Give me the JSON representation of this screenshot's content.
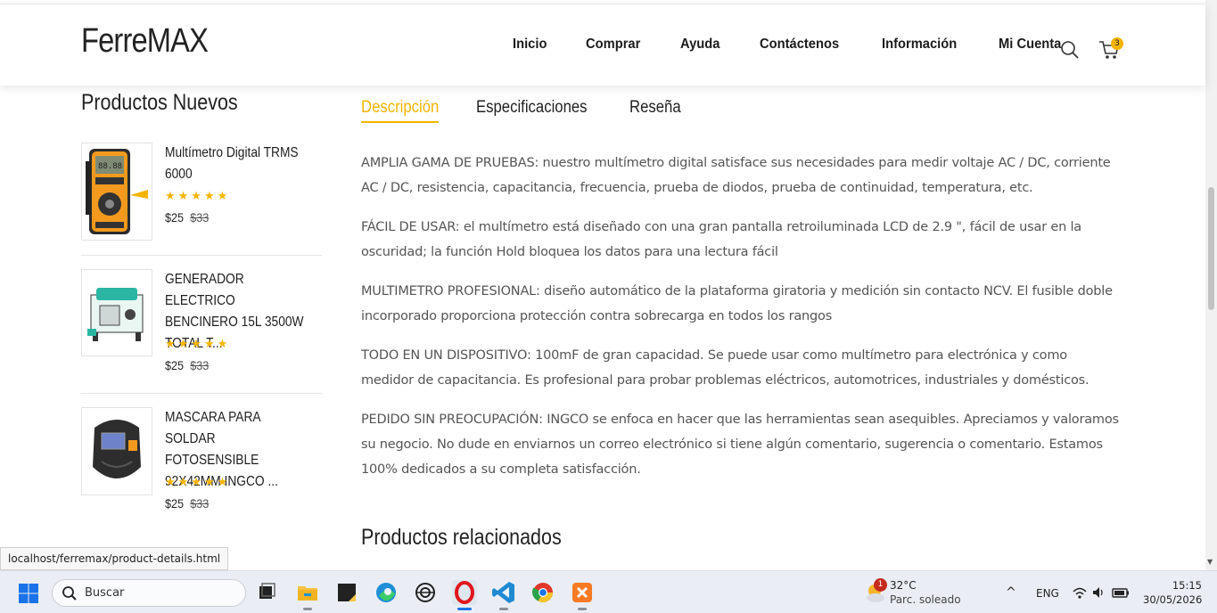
{
  "header": {
    "logo": "FerreMAX",
    "nav": [
      "Inicio",
      "Comprar",
      "Ayuda",
      "Contáctenos",
      "Información",
      "Mi Cuenta"
    ],
    "cart_count": "3"
  },
  "sidebar": {
    "title": "Productos Nuevos",
    "products": [
      {
        "name": "Multímetro Digital TRMS 6000",
        "stars": "★★★★★",
        "price": "$25",
        "old_price": "$33",
        "rating": 5
      },
      {
        "name": "GENERADOR ELECTRICO BENCINERO 15L 3500W TOTAL T...",
        "stars": "★★★★★",
        "price": "$25",
        "old_price": "$33",
        "rating": 5
      },
      {
        "name": "MASCARA PARA SOLDAR FOTOSENSIBLE 92X42MM INGCO ...",
        "stars": "★★★★★",
        "price": "$25",
        "old_price": "$33",
        "rating": 5
      }
    ]
  },
  "tabs": [
    {
      "label": "Descripción",
      "active": true
    },
    {
      "label": "Especificaciones",
      "active": false
    },
    {
      "label": "Reseña",
      "active": false
    }
  ],
  "description": [
    "AMPLIA GAMA DE PRUEBAS: nuestro multímetro digital satisface sus necesidades para medir voltaje AC / DC, corriente AC / DC, resistencia, capacitancia, frecuencia, prueba de diodos, prueba de continuidad, temperatura, etc.",
    "FÁCIL DE USAR: el multímetro está diseñado con una gran pantalla retroiluminada LCD de 2.9 \", fácil de usar en la oscuridad; la función Hold bloquea los datos para una lectura fácil",
    "MULTIMETRO PROFESIONAL: diseño automático de la plataforma giratoria y medición sin contacto NCV. El fusible doble incorporado proporciona protección contra sobrecarga en todos los rangos",
    "TODO EN UN DISPOSITIVO: 100mF de gran capacidad. Se puede usar como multímetro para electrónica y como medidor de capacitancia. Es profesional para probar problemas eléctricos, automotrices, industriales y domésticos.",
    "PEDIDO SIN PREOCUPACIÓN: INGCO se enfoca en hacer que las herramientas sean asequibles. Apreciamos y valoramos su negocio. No dude en enviarnos un correo electrónico si tiene algún comentario, sugerencia o comentario. Estamos 100% dedicados a su completa satisfacción."
  ],
  "related_title": "Productos relacionados",
  "status_url": "localhost/ferremax/product-details.html",
  "taskbar": {
    "search_placeholder": "Buscar",
    "apps": [
      "task-view",
      "file-explorer",
      "sticky-notes",
      "edge",
      "chatgpt",
      "opera",
      "vscode",
      "chrome",
      "xampp"
    ],
    "weather_temp": "32°C",
    "weather_desc": "Parc. soleado",
    "weather_badge": "1",
    "lang": "ENG",
    "time": "15:15",
    "date": "30/05/2026"
  },
  "colors": {
    "accent": "#f4b400",
    "text_dark": "#222222",
    "text_body": "#555555"
  }
}
